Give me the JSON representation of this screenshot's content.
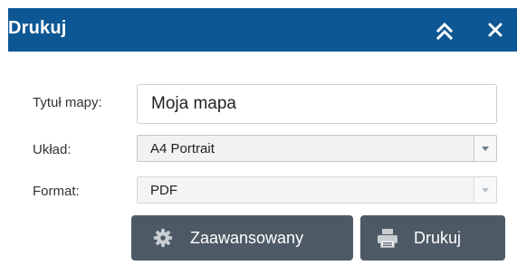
{
  "header": {
    "title": "Drukuj",
    "collapse_icon": "double-chevron-up-icon",
    "close_icon": "close-icon",
    "background_color": "#0d5794"
  },
  "form": {
    "map_title": {
      "label": "Tytuł mapy:",
      "value": "Moja mapa"
    },
    "layout": {
      "label": "Układ:",
      "selected": "A4 Portrait"
    },
    "format": {
      "label": "Format:",
      "selected": "PDF",
      "disabled": true
    }
  },
  "buttons": {
    "advanced": {
      "label": "Zaawansowany",
      "icon": "gear-icon"
    },
    "print": {
      "label": "Drukuj",
      "icon": "printer-icon"
    },
    "background_color": "#4d5a66"
  }
}
